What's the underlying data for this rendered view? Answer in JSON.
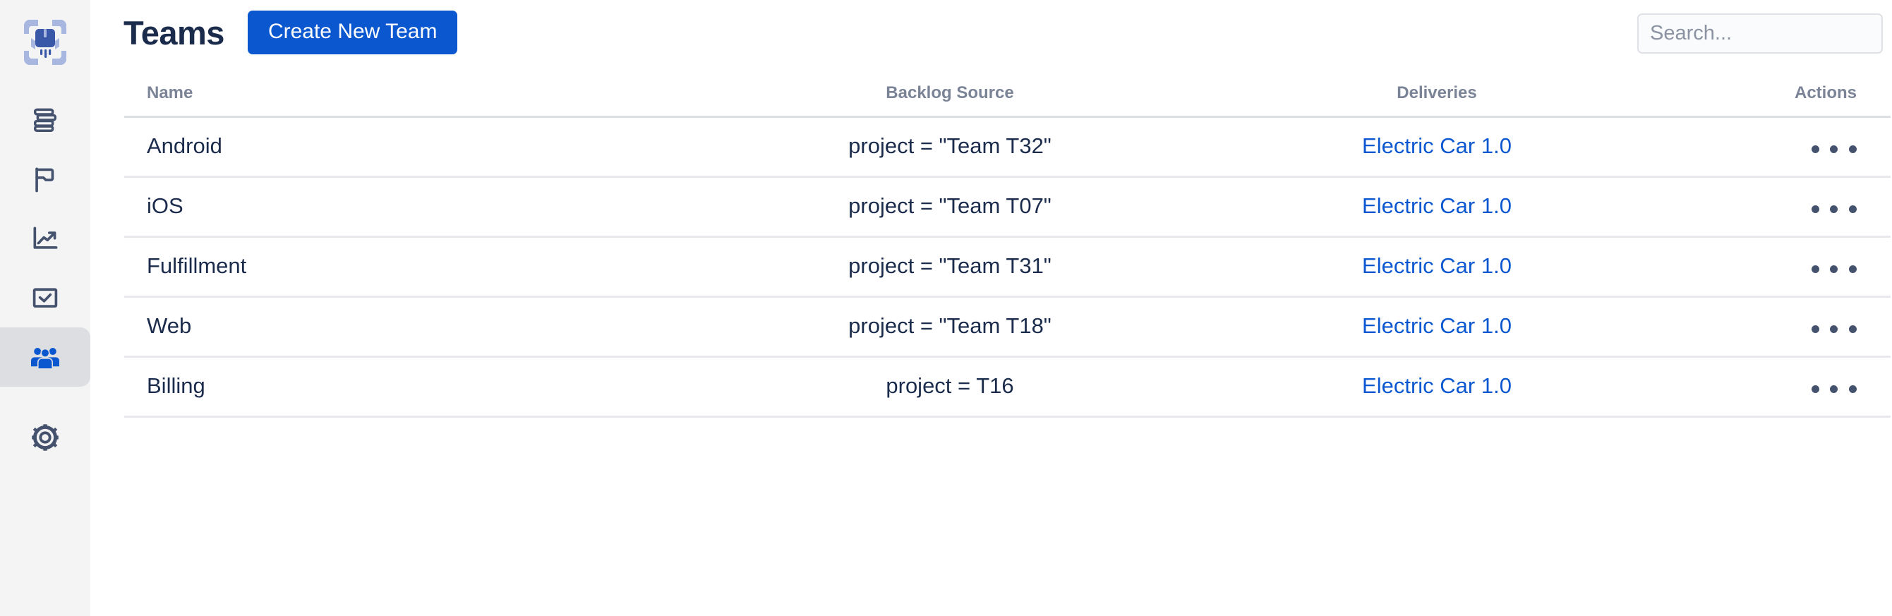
{
  "app": {
    "logo_name": "package-scan-logo",
    "accent_color": "#0b57d0",
    "sidebar_bg": "#f4f4f5",
    "active_item_bg": "#dcdee2",
    "title_color": "#1b2b4b",
    "muted_color": "#7b8496"
  },
  "sidebar": {
    "items": [
      {
        "name": "sidebar-item-backlog",
        "icon": "stacked-layers-icon",
        "active": false
      },
      {
        "name": "sidebar-item-milestones",
        "icon": "flag-icon",
        "active": false
      },
      {
        "name": "sidebar-item-analytics",
        "icon": "trending-up-icon",
        "active": false
      },
      {
        "name": "sidebar-item-tasks",
        "icon": "checkbox-square-icon",
        "active": false
      },
      {
        "name": "sidebar-item-teams",
        "icon": "people-group-icon",
        "active": true
      },
      {
        "name": "sidebar-item-settings",
        "icon": "gear-icon",
        "active": false
      }
    ]
  },
  "header": {
    "title": "Teams",
    "create_button_label": "Create New Team"
  },
  "search": {
    "value": "",
    "placeholder": "Search..."
  },
  "table": {
    "columns": [
      "Name",
      "Backlog Source",
      "Deliveries",
      "Actions"
    ],
    "rows": [
      {
        "name": "Android",
        "backlog_source": "project = \"Team T32\"",
        "delivery": "Electric Car 1.0",
        "actions": "•••"
      },
      {
        "name": "iOS",
        "backlog_source": "project = \"Team T07\"",
        "delivery": "Electric Car 1.0",
        "actions": "•••"
      },
      {
        "name": "Fulfillment",
        "backlog_source": "project = \"Team T31\"",
        "delivery": "Electric Car 1.0",
        "actions": "•••"
      },
      {
        "name": "Web",
        "backlog_source": "project = \"Team T18\"",
        "delivery": "Electric Car 1.0",
        "actions": "•••"
      },
      {
        "name": "Billing",
        "backlog_source": "project = T16",
        "delivery": "Electric Car 1.0",
        "actions": "•••"
      }
    ]
  }
}
